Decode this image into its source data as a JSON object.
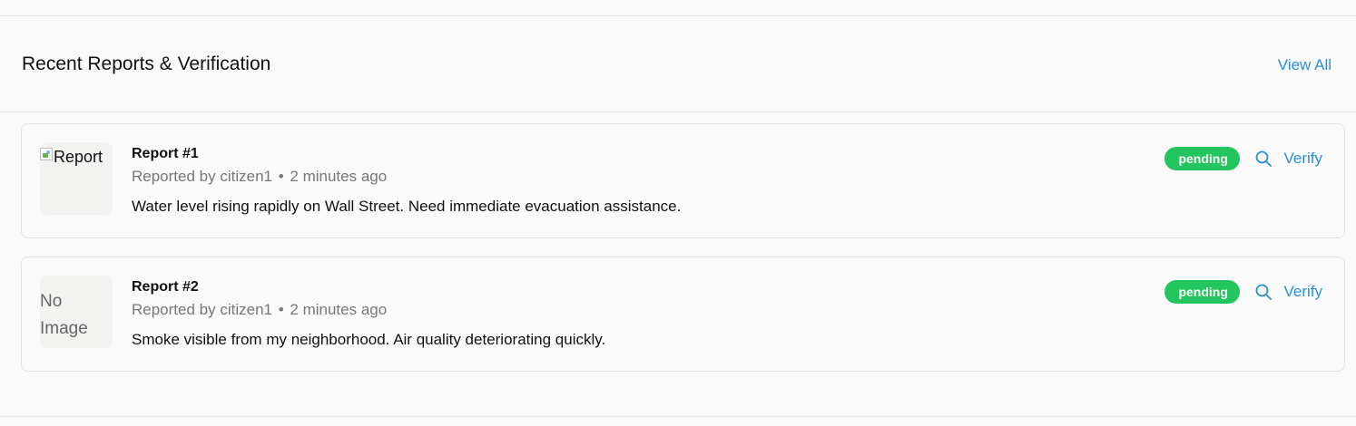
{
  "header": {
    "title": "Recent Reports & Verification",
    "view_all_label": "View All"
  },
  "colors": {
    "accent": "#2b8fd8",
    "status_pending": "#22c55e"
  },
  "reports": [
    {
      "title": "Report #1",
      "reported_by": "Reported by citizen1",
      "separator": "•",
      "time": "2 minutes ago",
      "description": "Water level rising rapidly on Wall Street. Need immediate evacuation assistance.",
      "status": "pending",
      "image_alt": "Report",
      "image_state": "broken",
      "search_icon": "search-icon",
      "verify_label": "Verify"
    },
    {
      "title": "Report #2",
      "reported_by": "Reported by citizen1",
      "separator": "•",
      "time": "2 minutes ago",
      "description": "Smoke visible from my neighborhood. Air quality deteriorating quickly.",
      "status": "pending",
      "no_image_label": "No Image",
      "image_state": "none",
      "search_icon": "search-icon",
      "verify_label": "Verify"
    }
  ]
}
